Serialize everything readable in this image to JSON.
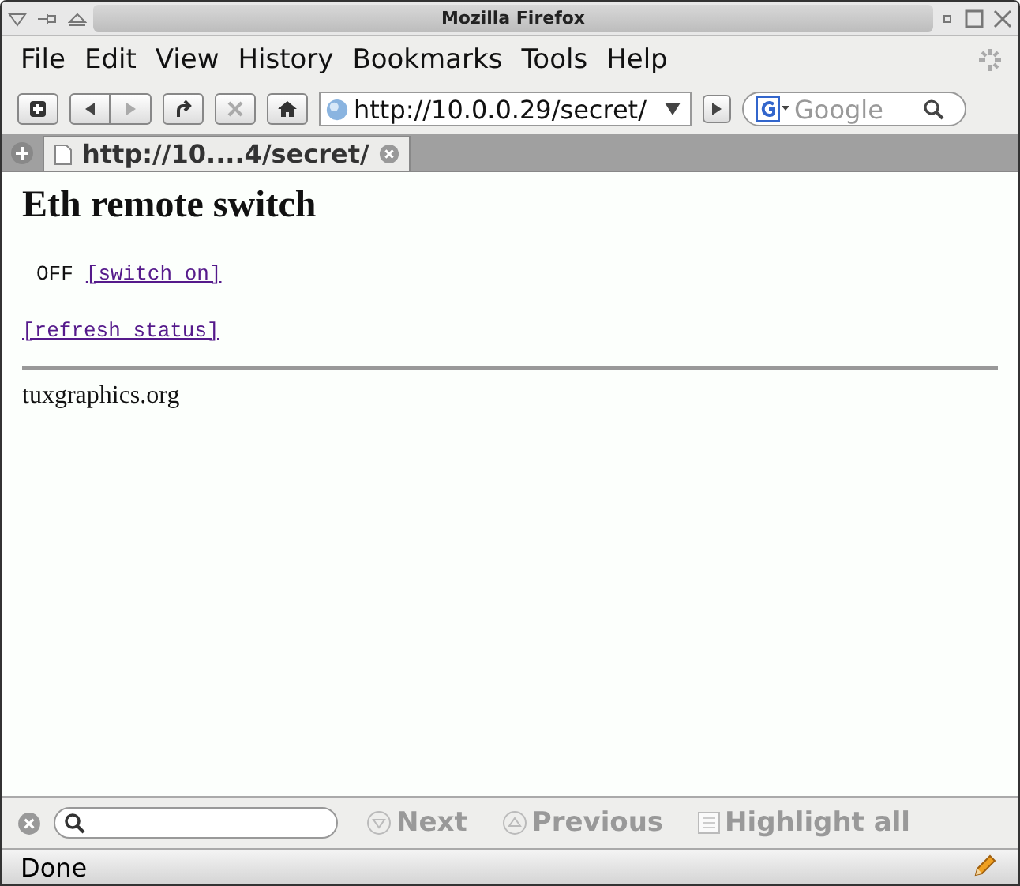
{
  "window": {
    "title": "Mozilla Firefox"
  },
  "menu": [
    "File",
    "Edit",
    "View",
    "History",
    "Bookmarks",
    "Tools",
    "Help"
  ],
  "navigation": {
    "url": "http://10.0.0.29/secret/",
    "search_placeholder": "Google"
  },
  "tabs": [
    {
      "label": "http://10....4/secret/",
      "selected": true
    }
  ],
  "page": {
    "heading": "Eth remote switch",
    "status": "OFF",
    "switch_link": "[switch on]",
    "refresh_link": "[refresh status]",
    "footer": "tuxgraphics.org"
  },
  "find_bar": {
    "buttons": [
      {
        "label": "Next",
        "kind": "down",
        "disabled": true
      },
      {
        "label": "Previous",
        "kind": "up",
        "disabled": true
      },
      {
        "label": "Highlight all",
        "kind": "check",
        "disabled": true
      }
    ]
  },
  "status_bar": "Done"
}
